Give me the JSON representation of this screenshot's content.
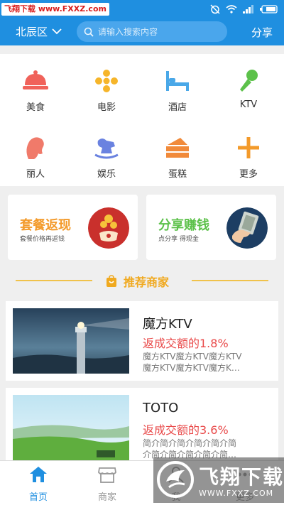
{
  "status_bar": {
    "watermark_tag": "飞翔下载 www.FXXZ.com",
    "icons": [
      "alarm-off-icon",
      "wifi-icon",
      "signal-icon",
      "battery-icon"
    ]
  },
  "header": {
    "district": "北辰区",
    "search_placeholder": "请输入搜索内容",
    "share_label": "分享",
    "accent_color": "#1f8fe0"
  },
  "categories": [
    {
      "label": "美食",
      "icon": "food-cloche-icon",
      "color": "#f0625a"
    },
    {
      "label": "电影",
      "icon": "film-reel-icon",
      "color": "#f6b52a"
    },
    {
      "label": "酒店",
      "icon": "bed-icon",
      "color": "#4aa8e8"
    },
    {
      "label": "KTV",
      "icon": "microphone-icon",
      "color": "#5cc14a"
    },
    {
      "label": "丽人",
      "icon": "beauty-face-icon",
      "color": "#f07a6a"
    },
    {
      "label": "娱乐",
      "icon": "rocking-horse-icon",
      "color": "#6a82e0"
    },
    {
      "label": "蛋糕",
      "icon": "cake-icon",
      "color": "#f18a3a"
    },
    {
      "label": "更多",
      "icon": "plus-icon",
      "color": "#f39a2a"
    }
  ],
  "promos": [
    {
      "title": "套餐返现",
      "subtitle": "套餐价格再返钱",
      "title_color": "#f39a2a",
      "icon": "gift-coins-icon"
    },
    {
      "title": "分享赚钱",
      "subtitle": "点分享 得现金",
      "title_color": "#5cc14a",
      "icon": "cash-in-hand-icon"
    }
  ],
  "recommended": {
    "title": "推荐商家",
    "icon": "shop-bag-icon",
    "merchants": [
      {
        "name": "魔方KTV",
        "rebate": "返成交额的1.8%",
        "desc_line1": "魔方KTV魔方KTV魔方KTV",
        "desc_line2": "魔方KTV魔方KTV魔方K…"
      },
      {
        "name": "TOTO",
        "rebate": "返成交额的3.6%",
        "desc_line1": "简介简介简介简介简介简",
        "desc_line2": "介简介简介简介简介简…"
      }
    ]
  },
  "bottom_nav": [
    {
      "label": "首页",
      "icon": "home-icon",
      "active": true
    },
    {
      "label": "商家",
      "icon": "store-icon",
      "active": false
    },
    {
      "label": "我",
      "icon": "user-icon",
      "active": false
    },
    {
      "label": "更多",
      "icon": "more-icon",
      "active": false
    }
  ],
  "watermark": {
    "big": "飞翔下载",
    "url": "WWW.FXXZ.COM"
  }
}
